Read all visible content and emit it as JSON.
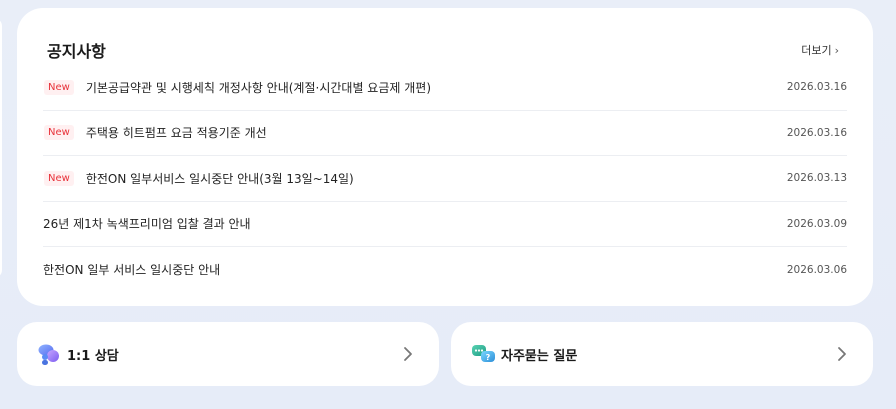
{
  "notice": {
    "title": "공지사항",
    "more_label": "더보기",
    "new_badge": "New",
    "items": [
      {
        "title": "기본공급약관 및 시행세칙 개정사항 안내(계절·시간대별 요금제 개편)",
        "date": "2026.03.16",
        "is_new": true
      },
      {
        "title": "주택용 히트펌프 요금 적용기준 개선",
        "date": "2026.03.16",
        "is_new": true
      },
      {
        "title": "한전ON 일부서비스 일시중단 안내(3월 13일~14일)",
        "date": "2026.03.13",
        "is_new": true
      },
      {
        "title": "26년 제1차 녹색프리미엄 입찰 결과 안내",
        "date": "2026.03.09",
        "is_new": false
      },
      {
        "title": "한전ON 일부 서비스 일시중단 안내",
        "date": "2026.03.06",
        "is_new": false
      }
    ]
  },
  "cards": {
    "consult": {
      "label": "1:1 상담",
      "icon": "chat-bubbles-icon"
    },
    "faq": {
      "label": "자주묻는 질문",
      "icon": "faq-bubbles-icon"
    }
  },
  "colors": {
    "new_badge_text": "#e8333b",
    "new_badge_bg": "#fff0f1",
    "page_bg": "#e8edf8"
  }
}
